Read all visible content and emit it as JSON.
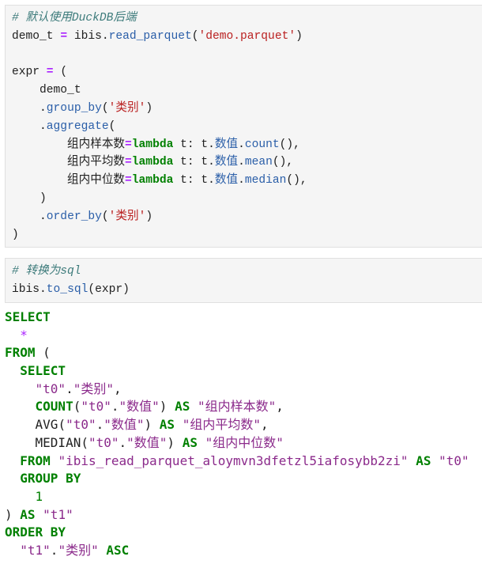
{
  "cells": [
    {
      "type": "code",
      "lines": [
        [
          {
            "t": "c",
            "v": "# 默认使用DuckDB后端"
          }
        ],
        [
          {
            "t": "n",
            "v": "demo_t "
          },
          {
            "t": "o",
            "v": "="
          },
          {
            "t": "n",
            "v": " ibis."
          },
          {
            "t": "a",
            "v": "read_parquet"
          },
          {
            "t": "p",
            "v": "("
          },
          {
            "t": "s",
            "v": "'demo.parquet'"
          },
          {
            "t": "p",
            "v": ")"
          }
        ],
        [],
        [
          {
            "t": "n",
            "v": "expr "
          },
          {
            "t": "o",
            "v": "="
          },
          {
            "t": "p",
            "v": " ("
          }
        ],
        [
          {
            "t": "n",
            "v": "    demo_t"
          }
        ],
        [
          {
            "t": "n",
            "v": "    ."
          },
          {
            "t": "a",
            "v": "group_by"
          },
          {
            "t": "p",
            "v": "("
          },
          {
            "t": "s",
            "v": "'类别'"
          },
          {
            "t": "p",
            "v": ")"
          }
        ],
        [
          {
            "t": "n",
            "v": "    ."
          },
          {
            "t": "a",
            "v": "aggregate"
          },
          {
            "t": "p",
            "v": "("
          }
        ],
        [
          {
            "t": "n",
            "v": "        组内样本数"
          },
          {
            "t": "o",
            "v": "="
          },
          {
            "t": "k",
            "v": "lambda"
          },
          {
            "t": "n",
            "v": " t: t."
          },
          {
            "t": "a",
            "v": "数值"
          },
          {
            "t": "n",
            "v": "."
          },
          {
            "t": "a",
            "v": "count"
          },
          {
            "t": "p",
            "v": "(),"
          }
        ],
        [
          {
            "t": "n",
            "v": "        组内平均数"
          },
          {
            "t": "o",
            "v": "="
          },
          {
            "t": "k",
            "v": "lambda"
          },
          {
            "t": "n",
            "v": " t: t."
          },
          {
            "t": "a",
            "v": "数值"
          },
          {
            "t": "n",
            "v": "."
          },
          {
            "t": "a",
            "v": "mean"
          },
          {
            "t": "p",
            "v": "(),"
          }
        ],
        [
          {
            "t": "n",
            "v": "        组内中位数"
          },
          {
            "t": "o",
            "v": "="
          },
          {
            "t": "k",
            "v": "lambda"
          },
          {
            "t": "n",
            "v": " t: t."
          },
          {
            "t": "a",
            "v": "数值"
          },
          {
            "t": "n",
            "v": "."
          },
          {
            "t": "a",
            "v": "median"
          },
          {
            "t": "p",
            "v": "(),"
          }
        ],
        [
          {
            "t": "p",
            "v": "    )"
          }
        ],
        [
          {
            "t": "n",
            "v": "    ."
          },
          {
            "t": "a",
            "v": "order_by"
          },
          {
            "t": "p",
            "v": "("
          },
          {
            "t": "s",
            "v": "'类别'"
          },
          {
            "t": "p",
            "v": ")"
          }
        ],
        [
          {
            "t": "p",
            "v": ")"
          }
        ]
      ]
    },
    {
      "type": "code",
      "lines": [
        [
          {
            "t": "c",
            "v": "# 转换为sql"
          }
        ],
        [
          {
            "t": "n",
            "v": "ibis."
          },
          {
            "t": "a",
            "v": "to_sql"
          },
          {
            "t": "p",
            "v": "(expr)"
          }
        ]
      ]
    }
  ],
  "output": {
    "type": "sql",
    "lines": [
      [
        {
          "t": "sk",
          "v": "SELECT"
        }
      ],
      [
        {
          "t": "n",
          "v": "  "
        },
        {
          "t": "sm",
          "v": "*"
        }
      ],
      [
        {
          "t": "sk",
          "v": "FROM"
        },
        {
          "t": "p",
          "v": " ("
        }
      ],
      [
        {
          "t": "n",
          "v": "  "
        },
        {
          "t": "sk",
          "v": "SELECT"
        }
      ],
      [
        {
          "t": "n",
          "v": "    "
        },
        {
          "t": "ss",
          "v": "\"t0\""
        },
        {
          "t": "p",
          "v": "."
        },
        {
          "t": "ss",
          "v": "\"类别\""
        },
        {
          "t": "p",
          "v": ","
        }
      ],
      [
        {
          "t": "n",
          "v": "    "
        },
        {
          "t": "sk",
          "v": "COUNT"
        },
        {
          "t": "p",
          "v": "("
        },
        {
          "t": "ss",
          "v": "\"t0\""
        },
        {
          "t": "p",
          "v": "."
        },
        {
          "t": "ss",
          "v": "\"数值\""
        },
        {
          "t": "p",
          "v": ") "
        },
        {
          "t": "sk",
          "v": "AS"
        },
        {
          "t": "n",
          "v": " "
        },
        {
          "t": "ss",
          "v": "\"组内样本数\""
        },
        {
          "t": "p",
          "v": ","
        }
      ],
      [
        {
          "t": "n",
          "v": "    AVG"
        },
        {
          "t": "p",
          "v": "("
        },
        {
          "t": "ss",
          "v": "\"t0\""
        },
        {
          "t": "p",
          "v": "."
        },
        {
          "t": "ss",
          "v": "\"数值\""
        },
        {
          "t": "p",
          "v": ") "
        },
        {
          "t": "sk",
          "v": "AS"
        },
        {
          "t": "n",
          "v": " "
        },
        {
          "t": "ss",
          "v": "\"组内平均数\""
        },
        {
          "t": "p",
          "v": ","
        }
      ],
      [
        {
          "t": "n",
          "v": "    MEDIAN"
        },
        {
          "t": "p",
          "v": "("
        },
        {
          "t": "ss",
          "v": "\"t0\""
        },
        {
          "t": "p",
          "v": "."
        },
        {
          "t": "ss",
          "v": "\"数值\""
        },
        {
          "t": "p",
          "v": ") "
        },
        {
          "t": "sk",
          "v": "AS"
        },
        {
          "t": "n",
          "v": " "
        },
        {
          "t": "ss",
          "v": "\"组内中位数\""
        }
      ],
      [
        {
          "t": "n",
          "v": "  "
        },
        {
          "t": "sk",
          "v": "FROM"
        },
        {
          "t": "n",
          "v": " "
        },
        {
          "t": "ss",
          "v": "\"ibis_read_parquet_aloymvn3dfetzl5iafosybb2zi\""
        },
        {
          "t": "n",
          "v": " "
        },
        {
          "t": "sk",
          "v": "AS"
        },
        {
          "t": "n",
          "v": " "
        },
        {
          "t": "ss",
          "v": "\"t0\""
        }
      ],
      [
        {
          "t": "n",
          "v": "  "
        },
        {
          "t": "sk",
          "v": "GROUP BY"
        }
      ],
      [
        {
          "t": "n",
          "v": "    "
        },
        {
          "t": "sn",
          "v": "1"
        }
      ],
      [
        {
          "t": "p",
          "v": ") "
        },
        {
          "t": "sk",
          "v": "AS"
        },
        {
          "t": "n",
          "v": " "
        },
        {
          "t": "ss",
          "v": "\"t1\""
        }
      ],
      [
        {
          "t": "sk",
          "v": "ORDER BY"
        }
      ],
      [
        {
          "t": "n",
          "v": "  "
        },
        {
          "t": "ss",
          "v": "\"t1\""
        },
        {
          "t": "p",
          "v": "."
        },
        {
          "t": "ss",
          "v": "\"类别\""
        },
        {
          "t": "n",
          "v": " "
        },
        {
          "t": "sk",
          "v": "ASC"
        }
      ]
    ]
  }
}
